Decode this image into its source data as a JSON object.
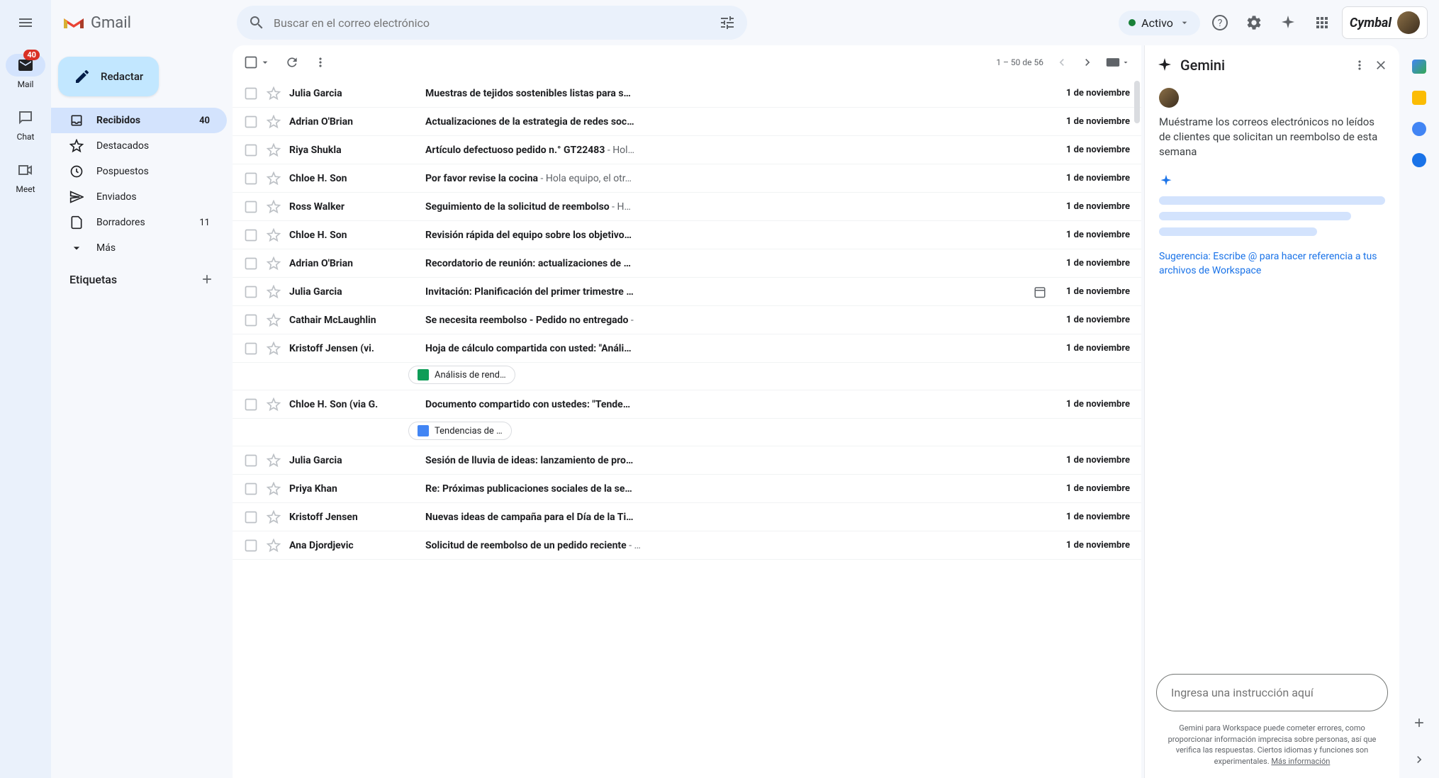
{
  "app_name": "Gmail",
  "search_placeholder": "Buscar en el correo electrónico",
  "status": "Activo",
  "brand": "Cymbal",
  "rail": {
    "mail": {
      "label": "Mail",
      "badge": "40"
    },
    "chat": {
      "label": "Chat"
    },
    "meet": {
      "label": "Meet"
    }
  },
  "compose": "Redactar",
  "nav": [
    {
      "icon": "inbox",
      "label": "Recibidos",
      "count": "40",
      "active": true
    },
    {
      "icon": "star",
      "label": "Destacados"
    },
    {
      "icon": "clock",
      "label": "Pospuestos"
    },
    {
      "icon": "send",
      "label": "Enviados"
    },
    {
      "icon": "draft",
      "label": "Borradores",
      "count": "11"
    },
    {
      "icon": "more",
      "label": "Más"
    }
  ],
  "labels_header": "Etiquetas",
  "pagination": "1 – 50 de 56",
  "emails": [
    {
      "sender": "Julia Garcia",
      "subject": "Muestras de tejidos sostenibles listas para s…",
      "preview": "",
      "date": "1 de noviembre",
      "unread": true
    },
    {
      "sender": "Adrian O'Brian",
      "subject": "Actualizaciones de la estrategia de redes soc…",
      "preview": "",
      "date": "1 de noviembre",
      "unread": true
    },
    {
      "sender": "Riya Shukla",
      "subject": "Artículo defectuoso pedido n.° GT22483",
      "preview": " - Hol…",
      "date": "1 de noviembre",
      "unread": true
    },
    {
      "sender": "Chloe H. Son",
      "subject": "Por favor revise la cocina",
      "preview": " - Hola equipo, el otr…",
      "date": "1 de noviembre",
      "unread": true
    },
    {
      "sender": "Ross Walker",
      "subject": "Seguimiento de la solicitud de reembolso",
      "preview": " - H…",
      "date": "1 de noviembre",
      "unread": true
    },
    {
      "sender": "Chloe H. Son",
      "subject": "Revisión rápida del equipo sobre los objetivo…",
      "preview": "",
      "date": "1 de noviembre",
      "unread": true
    },
    {
      "sender": "Adrian O'Brian",
      "subject": "Recordatorio de reunión: actualizaciones de …",
      "preview": "",
      "date": "1 de noviembre",
      "unread": true
    },
    {
      "sender": "Julia Garcia",
      "subject": "Invitación: Planificación del primer trimestre …",
      "preview": "",
      "date": "1 de noviembre",
      "unread": true,
      "calendar": true
    },
    {
      "sender": "Cathair McLaughlin",
      "subject": "Se necesita reembolso - Pedido no entregado",
      "preview": " - ",
      "date": "1 de noviembre",
      "unread": true
    },
    {
      "sender": "Kristoff Jensen (vi.",
      "subject": "Hoja de cálculo compartida con usted: \"Análi…",
      "preview": "",
      "date": "1 de noviembre",
      "unread": true,
      "attachment": {
        "type": "sheets",
        "name": "Análisis de rend…"
      }
    },
    {
      "sender": "Chloe H. Son (via G.",
      "subject": "Documento compartido con ustedes: \"Tende…",
      "preview": "",
      "date": "1 de noviembre",
      "unread": true,
      "attachment": {
        "type": "docs",
        "name": "Tendencias de …"
      }
    },
    {
      "sender": "Julia Garcia",
      "subject": "Sesión de lluvia de ideas: lanzamiento de pro…",
      "preview": "",
      "date": "1 de noviembre",
      "unread": true
    },
    {
      "sender": "Priya Khan",
      "subject": "Re: Próximas publicaciones sociales de la se…",
      "preview": "",
      "date": "1 de noviembre",
      "unread": true
    },
    {
      "sender": "Kristoff Jensen",
      "subject": "Nuevas ideas de campaña para el Día de la Ti…",
      "preview": "",
      "date": "1 de noviembre",
      "unread": true
    },
    {
      "sender": "Ana Djordjevic",
      "subject": "Solicitud de reembolso de un pedido reciente",
      "preview": " - …",
      "date": "1 de noviembre",
      "unread": true
    }
  ],
  "gemini": {
    "title": "Gemini",
    "user_prompt": "Muéstrame los correos electrónicos no leídos de clientes que solicitan un reembolso de esta semana",
    "hint": "Sugerencia: Escribe @ para hacer referencia a tus archivos de Workspace",
    "input_placeholder": "Ingresa una instrucción aquí",
    "disclaimer": "Gemini para Workspace puede cometer errores, como proporcionar información imprecisa sobre personas, así que verifica las respuestas. Ciertos idiomas y funciones son experimentales. ",
    "more_info": "Más información"
  }
}
